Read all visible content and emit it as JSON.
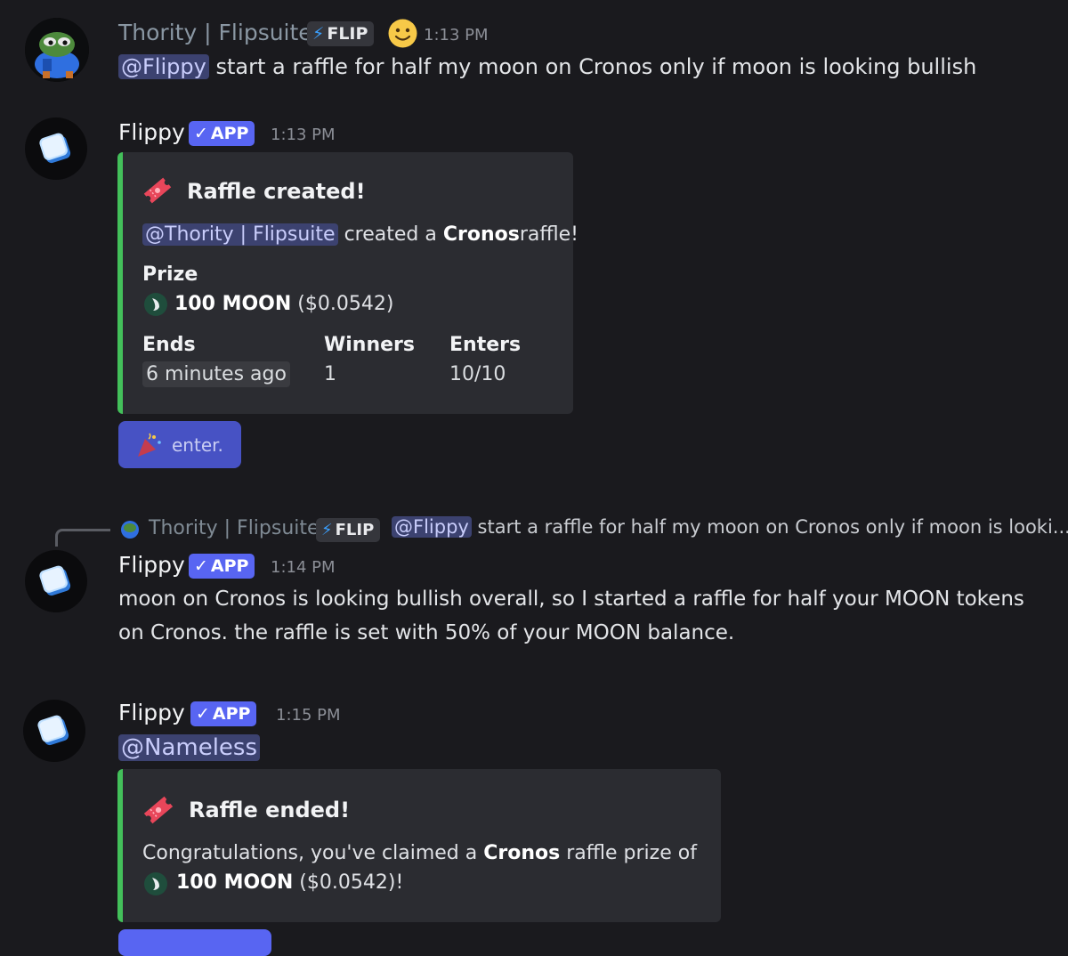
{
  "messages": [
    {
      "author": "Thority | Flipsuite",
      "tag": "FLIP",
      "tag_icon": "lightning-icon",
      "emoji": "slightly-smiling-face",
      "time": "1:13 PM",
      "mention": "@Flippy",
      "text": "start a raffle for half my moon on Cronos only if moon is looking bullish"
    },
    {
      "author": "Flippy",
      "tag": "APP",
      "tag_icon": "check-icon",
      "time": "1:13 PM",
      "embed": {
        "title_icon": "ticket-icon",
        "title": "Raffle created!",
        "creator_mention": "@Thority | Flipsuite",
        "desc_pre": "created a",
        "desc_bold": "Cronos",
        "desc_post": "raffle!",
        "prize_label": "Prize",
        "prize_amount": "100 MOON",
        "prize_value": "($0.0542)",
        "fields": [
          {
            "name": "Ends",
            "value": "6 minutes ago"
          },
          {
            "name": "Winners",
            "value": "1"
          },
          {
            "name": "Enters",
            "value": "10/10"
          }
        ],
        "accent": "#43c05a"
      },
      "button": {
        "icon": "party-popper-icon",
        "label": "enter."
      }
    },
    {
      "reply": {
        "author": "Thority | Flipsuite",
        "tag": "FLIP",
        "mention": "@Flippy",
        "text": "start a raffle for half my moon on Cronos only if moon is looki..."
      },
      "author": "Flippy",
      "tag": "APP",
      "time": "1:14 PM",
      "lines": [
        "moon on Cronos is looking bullish overall, so I started a raffle for half your MOON tokens",
        "on Cronos. the raffle is set with 50% of your MOON balance."
      ]
    },
    {
      "author": "Flippy",
      "tag": "APP",
      "time": "1:15 PM",
      "mention": "@Nameless",
      "embed": {
        "title_icon": "ticket-icon",
        "title": "Raffle ended!",
        "desc_pre": "Congratulations, you've claimed a",
        "desc_bold": "Cronos",
        "desc_post": "raffle prize of",
        "prize_amount": "100 MOON",
        "prize_value": "($0.0542)!"
      }
    }
  ],
  "colors": {
    "background": "#1a1a1e",
    "app_badge": "#5865f2",
    "mention_bg": "#3c4270",
    "embed_accent": "#43c05a",
    "button": "#4752c4"
  }
}
